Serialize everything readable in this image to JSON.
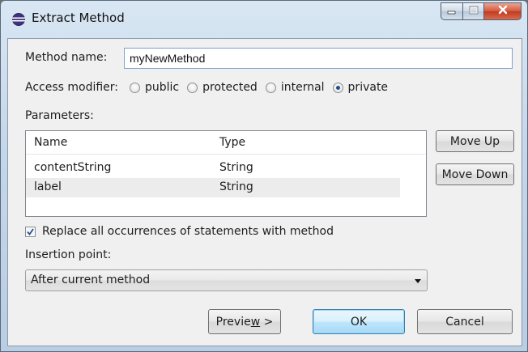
{
  "window": {
    "title": "Extract Method",
    "controls": {
      "minimize": "minimize",
      "maximize": "maximize",
      "close": "close"
    }
  },
  "form": {
    "method_name_label": "Method name:",
    "method_name_value": "myNewMethod",
    "access_modifier_label": "Access modifier:",
    "access_options": [
      {
        "label": "public",
        "checked": false
      },
      {
        "label": "protected",
        "checked": false
      },
      {
        "label": "internal",
        "checked": false
      },
      {
        "label": "private",
        "checked": true
      }
    ],
    "parameters_label": "Parameters:",
    "parameters_table": {
      "columns": [
        "Name",
        "Type"
      ],
      "rows": [
        {
          "name": "contentString",
          "type": "String"
        },
        {
          "name": "label",
          "type": "String"
        }
      ]
    },
    "move_up_label": "Move Up",
    "move_down_label": "Move Down",
    "replace_checkbox_label": "Replace all occurrences of statements with method",
    "replace_checked": true,
    "insertion_point_label": "Insertion point:",
    "insertion_point_value": "After current method"
  },
  "buttons": {
    "preview_label": "Preview >",
    "preview_mnemonic": "w",
    "ok_label": "OK",
    "cancel_label": "Cancel"
  }
}
